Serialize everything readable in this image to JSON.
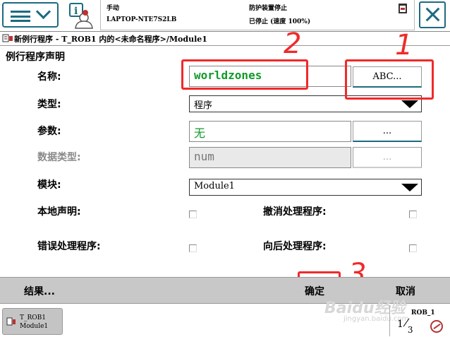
{
  "header": {
    "mode": "手动",
    "device": "LAPTOP-NTE7S2LB",
    "safety": "防护装置停止",
    "status": "已停止 (速度 100%)"
  },
  "breadcrumb": "新例行程序 - T_ROB1 内的<未命名程序>/Module1",
  "form": {
    "section_title": "例行程序声明",
    "name_label": "名称:",
    "name_value": "worldzones",
    "name_button": "ABC...",
    "type_label": "类型:",
    "type_value": "程序",
    "params_label": "参数:",
    "params_value": "无",
    "params_button": "...",
    "datatype_label": "数据类型:",
    "datatype_value": "num",
    "datatype_button": "...",
    "module_label": "模块:",
    "module_value": "Module1",
    "local_label": "本地声明:",
    "undo_label": "撤消处理程序:",
    "error_label": "错误处理程序:",
    "backward_label": "向后处理程序:"
  },
  "annotations": {
    "mark1": "1",
    "mark2": "2",
    "mark3": "3"
  },
  "actions": {
    "results": "结果...",
    "ok": "确定",
    "cancel": "取消"
  },
  "taskbar": {
    "task_line1": "T_ROB1",
    "task_line2": "Module1",
    "rob_label": "ROB_1",
    "frac_top": "1",
    "frac_bottom": "3"
  },
  "watermark": {
    "brand": "Baidu经验",
    "url": "jingyan.baidu.com"
  },
  "colors": {
    "accent": "#1c6b80",
    "annotation": "#f02a2a",
    "value_green": "#119a2b",
    "bar_gray": "#c8c8c8"
  }
}
